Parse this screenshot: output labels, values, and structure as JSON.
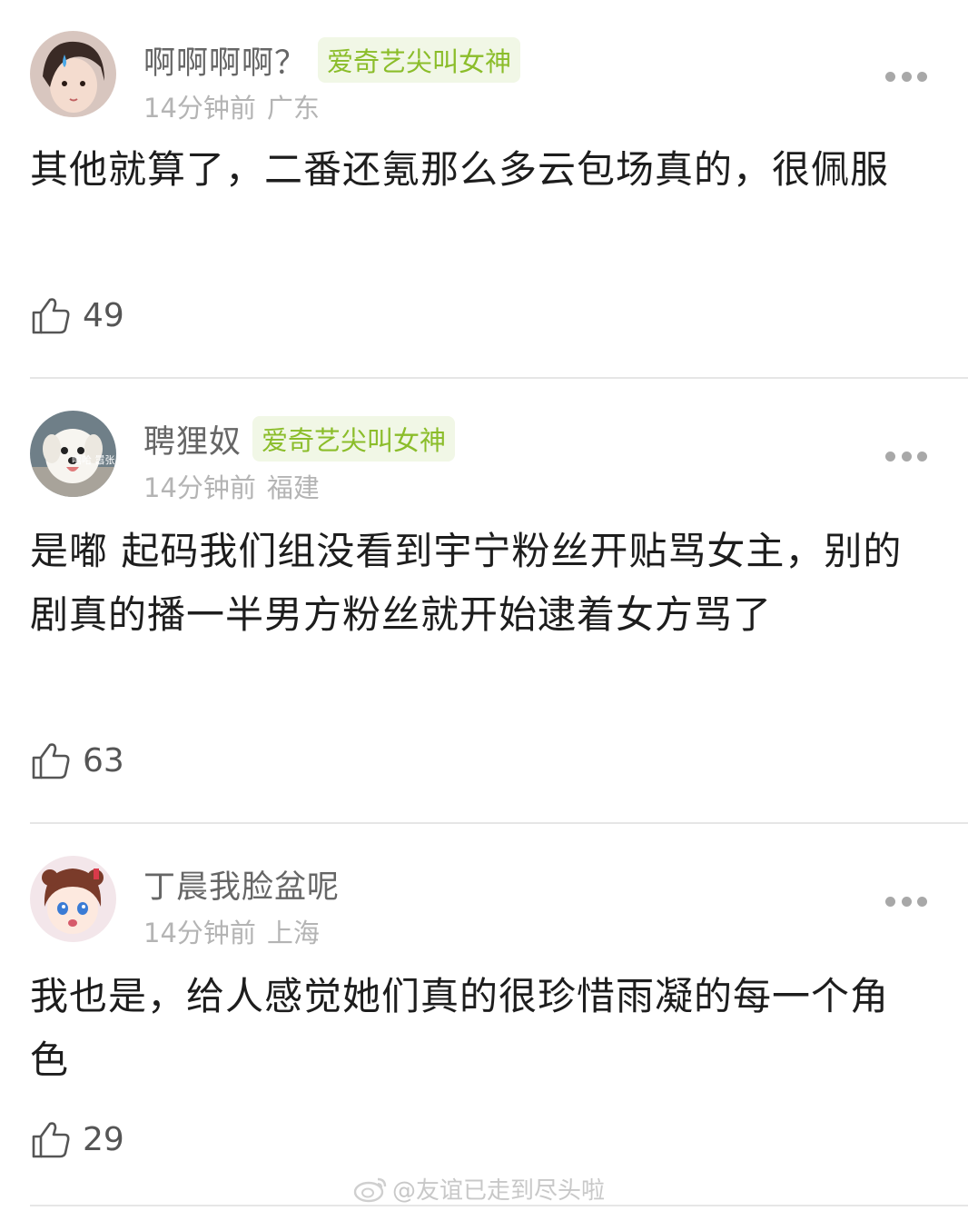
{
  "comments": [
    {
      "username": "啊啊啊啊？",
      "badge": "爱奇艺尖叫女神",
      "time": "14分钟前",
      "location": "广东",
      "text": "其他就算了，二番还氪那么多云包场真的，很佩服",
      "likes": "49",
      "avatar_icon": "girl-portrait-avatar"
    },
    {
      "username": "聘狸奴",
      "badge": "爱奇艺尖叫女神",
      "time": "14分钟前",
      "location": "福建",
      "text": "是嘟 起码我们组没看到宇宁粉丝开贴骂女主，别的剧真的播一半男方粉丝就开始逮着女方骂了",
      "likes": "63",
      "avatar_icon": "dog-avatar",
      "avatar_caption": "嘻哈 嚣张"
    },
    {
      "username": "丁晨我脸盆呢",
      "badge": "",
      "time": "14分钟前",
      "location": "上海",
      "text": "我也是，给人感觉她们真的很珍惜雨凝的每一个角色",
      "likes": "29",
      "avatar_icon": "cartoon-girl-avatar"
    }
  ],
  "watermark": "@友谊已走到尽头啦",
  "colors": {
    "badge_bg": "#f1f7e6",
    "badge_text": "#8bbd2a",
    "meta": "#b4b4b4",
    "divider": "#e6e6e6"
  }
}
